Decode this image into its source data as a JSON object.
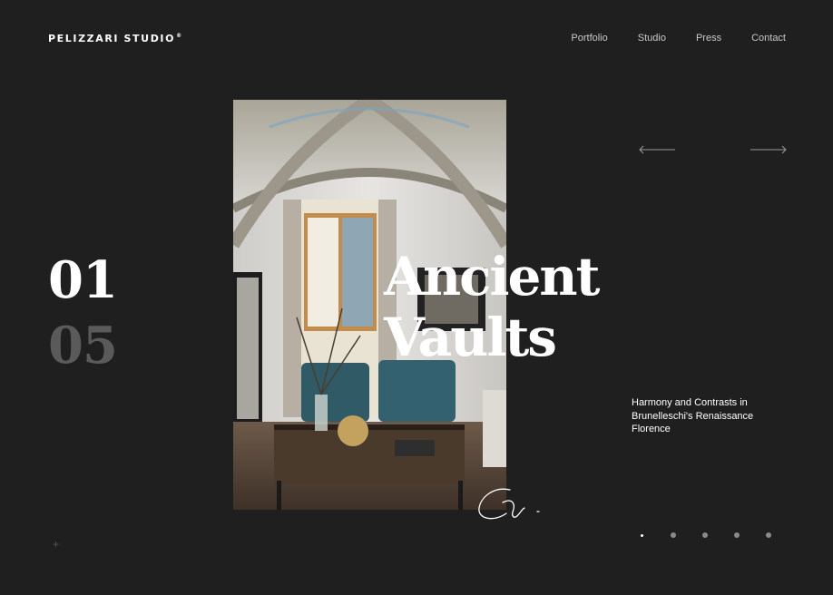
{
  "header": {
    "logo": "PELIZZARI STUDIO",
    "logo_mark": "®",
    "nav": [
      "Portfolio",
      "Studio",
      "Press",
      "Contact"
    ]
  },
  "slider": {
    "current": "01",
    "total": "05",
    "headline_line1": "Ancient",
    "headline_line2": "Vaults",
    "subtitle": "Harmony and Contrasts in Brunelleschi's Renaissance Florence",
    "active_dot": 1,
    "dot_count": 5
  },
  "icons": {
    "prev": "arrow-left-icon",
    "next": "arrow-right-icon",
    "plus": "plus-icon",
    "signature": "signature-logo"
  },
  "colors": {
    "background": "#1f1f1f",
    "text": "#ffffff",
    "muted": "#5a5a5a",
    "nav": "#c9c9c9"
  }
}
